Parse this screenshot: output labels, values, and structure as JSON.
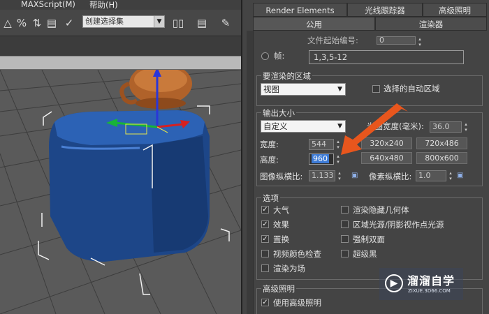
{
  "menubar": {
    "items": [
      "",
      "MAXScript(M)",
      "帮助(H)"
    ]
  },
  "toolbar": {
    "selection_set_value": "创建选择集"
  },
  "tabs": {
    "top": [
      "Render Elements",
      "光线跟踪器",
      "高级照明"
    ],
    "bottom": [
      "公用",
      "渲染器"
    ]
  },
  "frames_section": {
    "start_number_label": "文件起始编号:",
    "start_number_value": "0",
    "frames_label": "帧:",
    "frames_value": "1,3,5-12"
  },
  "area_to_render": {
    "title": "要渲染的区域",
    "mode": "视图",
    "auto_region_label": "选择的自动区域"
  },
  "output_size": {
    "title": "输出大小",
    "preset": "自定义",
    "aperture_label": "光圈宽度(毫米):",
    "aperture_value": "36.0",
    "width_label": "宽度:",
    "width_value": "544",
    "height_label": "高度:",
    "height_value": "960",
    "presets": [
      "320x240",
      "720x486",
      "640x480",
      "800x600"
    ],
    "image_aspect_label": "图像纵横比:",
    "image_aspect_value": "1.133",
    "pixel_aspect_label": "像素纵横比:",
    "pixel_aspect_value": "1.0"
  },
  "options": {
    "title": "选项",
    "left": [
      {
        "label": "大气",
        "checked": true
      },
      {
        "label": "效果",
        "checked": true
      },
      {
        "label": "置换",
        "checked": true
      },
      {
        "label": "视频颜色检查",
        "checked": false
      },
      {
        "label": "渲染为场",
        "checked": false
      }
    ],
    "right": [
      {
        "label": "渲染隐藏几何体",
        "checked": false
      },
      {
        "label": "区域光源/阴影视作点光源",
        "checked": false
      },
      {
        "label": "强制双面",
        "checked": false
      },
      {
        "label": "超级黑",
        "checked": false
      }
    ]
  },
  "advanced_lighting": {
    "title": "高级照明",
    "use_label": "使用高级照明",
    "use_checked": true
  },
  "watermark": {
    "main": "溜溜自学",
    "sub": "ZIXUE.3D66.COM"
  },
  "colors": {
    "object_blue": "#1f4a8f",
    "teapot": "#b0622a",
    "arrow": "#e8561d",
    "highlight": "#3d7bd6"
  }
}
